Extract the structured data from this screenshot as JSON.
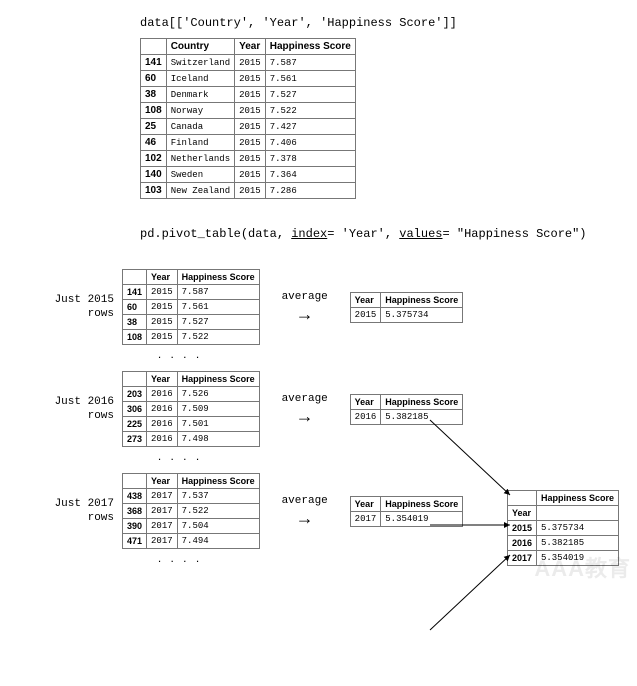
{
  "code_line1_a": "data[[",
  "code_line1_b": "'Country'",
  "code_line1_c": ", ",
  "code_line1_d": "'Year'",
  "code_line1_e": ", ",
  "code_line1_f": "'Happiness Score'",
  "code_line1_g": "]]",
  "table1": {
    "headers": [
      "",
      "Country",
      "Year",
      "Happiness Score"
    ],
    "rows": [
      {
        "idx": "141",
        "country": "Switzerland",
        "year": "2015",
        "score": "7.587"
      },
      {
        "idx": "60",
        "country": "Iceland",
        "year": "2015",
        "score": "7.561"
      },
      {
        "idx": "38",
        "country": "Denmark",
        "year": "2015",
        "score": "7.527"
      },
      {
        "idx": "108",
        "country": "Norway",
        "year": "2015",
        "score": "7.522"
      },
      {
        "idx": "25",
        "country": "Canada",
        "year": "2015",
        "score": "7.427"
      },
      {
        "idx": "46",
        "country": "Finland",
        "year": "2015",
        "score": "7.406"
      },
      {
        "idx": "102",
        "country": "Netherlands",
        "year": "2015",
        "score": "7.378"
      },
      {
        "idx": "140",
        "country": "Sweden",
        "year": "2015",
        "score": "7.364"
      },
      {
        "idx": "103",
        "country": "New Zealand",
        "year": "2015",
        "score": "7.286"
      }
    ]
  },
  "code_line2_a": "pd.pivot_table(data, ",
  "code_line2_b": "index",
  "code_line2_c": "= 'Year', ",
  "code_line2_d": "values",
  "code_line2_e": "= \"Happiness Score\")",
  "groupHeaders": [
    "",
    "Year",
    "Happiness Score"
  ],
  "avgHeaders": [
    "Year",
    "Happiness Score"
  ],
  "avgLabel": "average",
  "dots": ". . . .",
  "groups": [
    {
      "label1": "Just 2015",
      "label2": "rows",
      "rows": [
        {
          "idx": "141",
          "year": "2015",
          "score": "7.587"
        },
        {
          "idx": "60",
          "year": "2015",
          "score": "7.561"
        },
        {
          "idx": "38",
          "year": "2015",
          "score": "7.527"
        },
        {
          "idx": "108",
          "year": "2015",
          "score": "7.522"
        }
      ],
      "avg": {
        "year": "2015",
        "score": "5.375734"
      }
    },
    {
      "label1": "Just 2016",
      "label2": "rows",
      "rows": [
        {
          "idx": "203",
          "year": "2016",
          "score": "7.526"
        },
        {
          "idx": "306",
          "year": "2016",
          "score": "7.509"
        },
        {
          "idx": "225",
          "year": "2016",
          "score": "7.501"
        },
        {
          "idx": "273",
          "year": "2016",
          "score": "7.498"
        }
      ],
      "avg": {
        "year": "2016",
        "score": "5.382185"
      }
    },
    {
      "label1": "Just 2017",
      "label2": "rows",
      "rows": [
        {
          "idx": "438",
          "year": "2017",
          "score": "7.537"
        },
        {
          "idx": "368",
          "year": "2017",
          "score": "7.522"
        },
        {
          "idx": "390",
          "year": "2017",
          "score": "7.504"
        },
        {
          "idx": "471",
          "year": "2017",
          "score": "7.494"
        }
      ],
      "avg": {
        "year": "2017",
        "score": "5.354019"
      }
    }
  ],
  "final": {
    "corner": "",
    "scoreHeader": "Happiness Score",
    "yearHeader": "Year",
    "rows": [
      {
        "year": "2015",
        "score": "5.375734"
      },
      {
        "year": "2016",
        "score": "5.382185"
      },
      {
        "year": "2017",
        "score": "5.354019"
      }
    ]
  },
  "arrowGlyph": "→",
  "watermark": "AAA教育"
}
